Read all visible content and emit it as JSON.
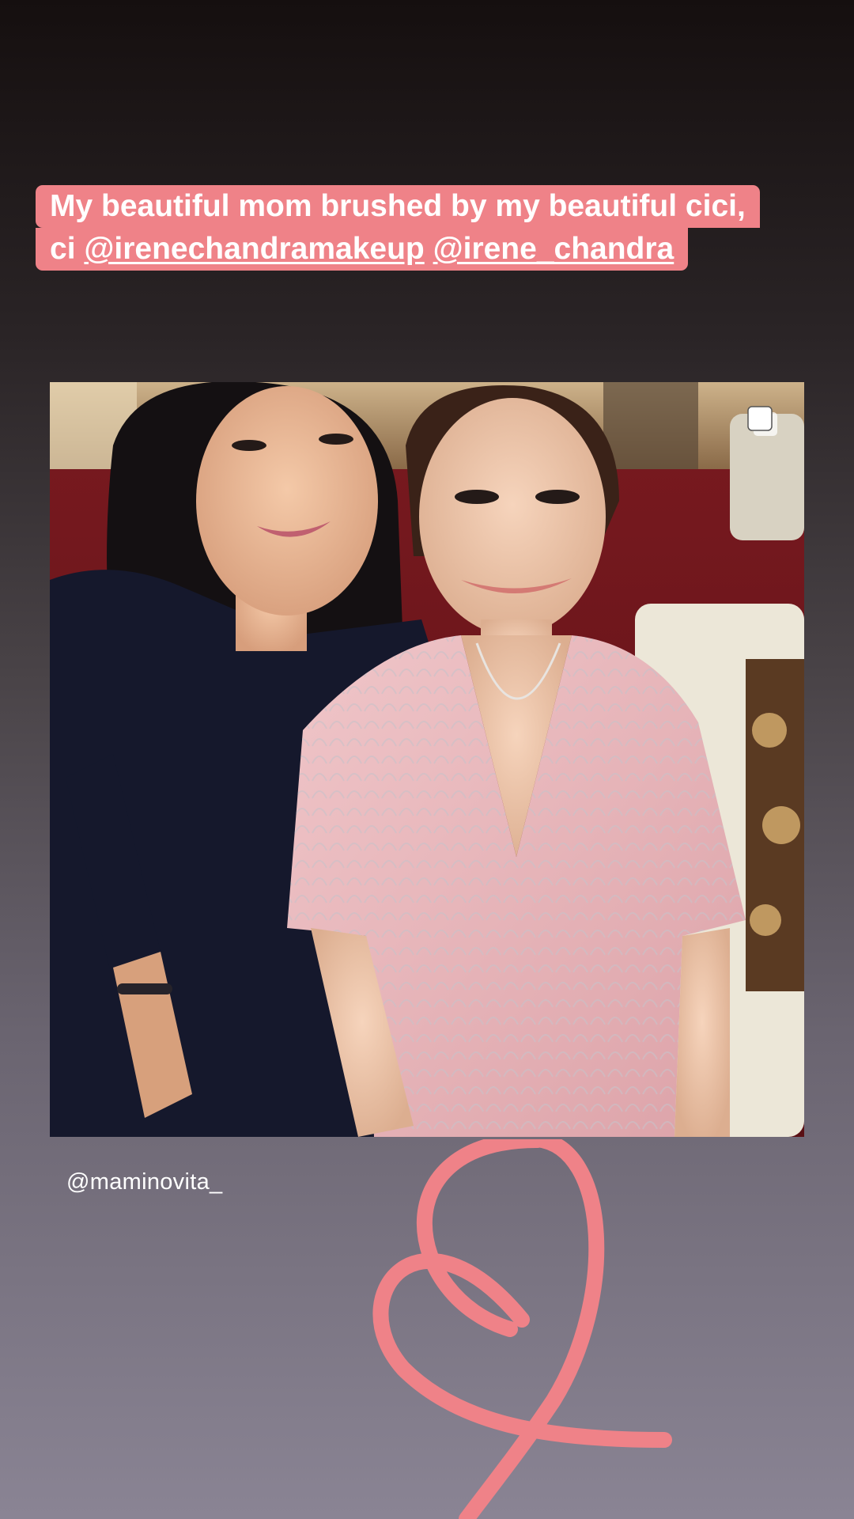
{
  "story": {
    "caption": {
      "line1": "My beautiful mom brushed by my beautiful cici,",
      "line2_prefix": "ci ",
      "mention1": "@irenechandramakeup",
      "mention2": "@irene_chandra",
      "background_color": "#ef8288"
    },
    "post": {
      "credit": "@maminovita_",
      "icon": "multiple-photos-icon"
    },
    "sticker": {
      "icon": "heart-icon",
      "color": "#ef8288"
    }
  }
}
